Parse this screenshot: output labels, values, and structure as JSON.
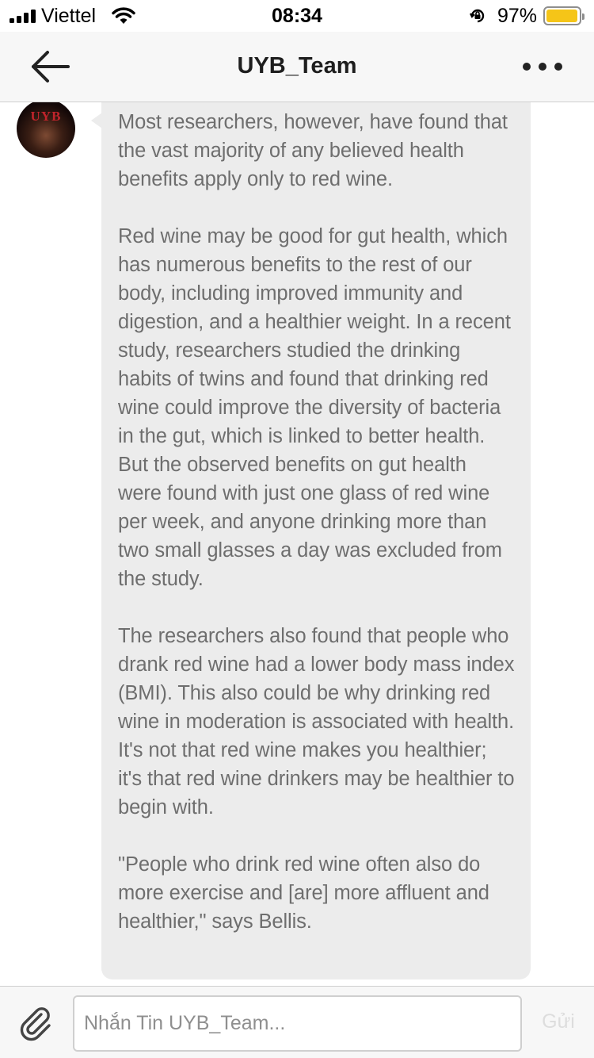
{
  "status_bar": {
    "carrier": "Viettel",
    "time": "08:34",
    "battery_percent": "97%",
    "battery_level": 0.97,
    "battery_color": "#f5c518",
    "icons": [
      "signal-icon",
      "wifi-icon",
      "orientation-lock-icon",
      "battery-icon"
    ]
  },
  "nav_bar": {
    "title": "UYB_Team",
    "back_icon": "arrow-left-icon",
    "more_icon": "more-dots-icon"
  },
  "chat": {
    "avatar_text": "UYB",
    "message_paragraphs": [
      "Most researchers, however, have found that the vast majority of any believed health benefits apply only to red wine.",
      "Red wine may be good for gut health, which has numerous benefits to the rest of our body, including improved immunity and digestion, and a healthier weight. In a recent study, researchers studied the drinking habits of twins and found that drinking red wine could improve the diversity of bacteria in the gut, which is linked to better health. But the observed benefits on gut health were found with just one glass of red wine per week, and anyone drinking more than two small glasses a day was excluded from the study.",
      "The researchers also found that people who drank red wine had a lower body mass index (BMI). This also could be why drinking red wine in moderation is associated with health. It's not that red wine makes you healthier; it's that red wine drinkers may be healthier to begin with.",
      "\"People who drink red wine often also do more exercise and [are] more affluent and healthier,\" says Bellis."
    ]
  },
  "input_bar": {
    "attach_icon": "paperclip-icon",
    "placeholder": "Nhắn Tin UYB_Team...",
    "value": "",
    "send_label": "Gửi"
  }
}
